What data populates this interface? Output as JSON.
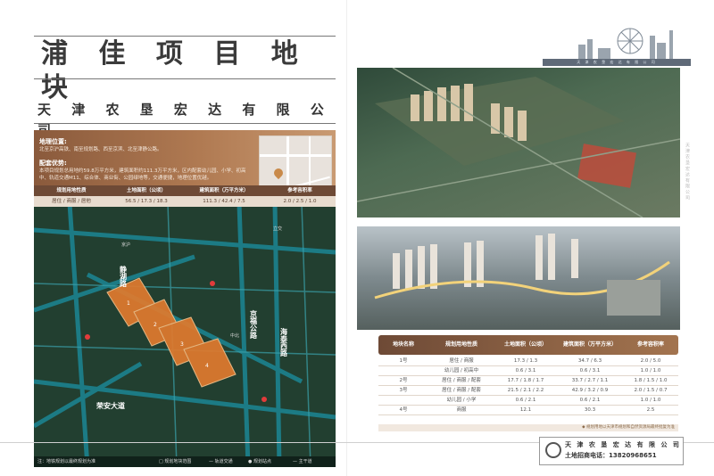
{
  "title": "浦 佳 项 目 地 块",
  "subtitle": "天 津 农 垦 宏 达 有 限 公 司",
  "info": {
    "location_title": "地理位置:",
    "location_text": "北至京沪高铁、南至规划路、西至京滨、北至津静公路。",
    "advantage_title": "配套优势:",
    "advantage_text": "本项目规划总用地约59.8万平方米，建筑面积约111.3万平方米，区内配套幼儿园、小学、初高中、轨道交通M11、综合体、商业街、公园绿地等，交通便捷，地理位置优越。"
  },
  "summary_table": {
    "headers": [
      "规划用地性质",
      "土地面积（公顷）",
      "建筑面积（万平方米）",
      "参考容积率"
    ],
    "row": [
      "居住 / 商服 / 居他",
      "56.5 / 17.3 / 18.3",
      "111.3 / 42.4 / 7.5",
      "2.0 / 2.5 / 1.0"
    ]
  },
  "map": {
    "parcels": [
      "1",
      "2",
      "3",
      "4"
    ],
    "roads": [
      "京福公路",
      "海泰西路",
      "静湖路",
      "荣安大道",
      "立交",
      "京沪",
      "中北"
    ],
    "legend": [
      "□ 规划地块范围",
      "— 轨道交通",
      "● 规划站点",
      "— 主干道"
    ],
    "legend_note": "注：地铁规划以最终规划为准"
  },
  "detail_table": {
    "headers": [
      "地块名称",
      "规划用地性质",
      "土地面积（公顷）",
      "建筑面积（万平方米）",
      "参考容积率"
    ],
    "rows": [
      [
        "1号",
        "居住 / 商服",
        "17.3 / 1.3",
        "34.7 / 6.3",
        "2.0 / 5.0"
      ],
      [
        "",
        "幼儿园 / 初高中",
        "0.6 / 3.1",
        "0.6 / 3.1",
        "1.0 / 1.0"
      ],
      [
        "2号",
        "居住 / 商服 / 配套",
        "17.7 / 1.8 / 1.7",
        "33.7 / 2.7 / 1.1",
        "1.8 / 1.5 / 1.0"
      ],
      [
        "3号",
        "居住 / 商服 / 配套",
        "21.5 / 2.1 / 2.2",
        "42.9 / 3.2 / 0.9",
        "2.0 / 1.5 / 0.7"
      ],
      [
        "",
        "幼儿园 / 小学",
        "0.6 / 2.1",
        "0.6 / 2.1",
        "1.0 / 1.0"
      ],
      [
        "4号",
        "商服",
        "12.1",
        "30.3",
        "2.5"
      ]
    ],
    "note": "◆ 规划用地以天津市规划和自然资源局最终批复为准"
  },
  "contact": {
    "company": "天 津 农 垦 宏 达 有 限 公 司",
    "phone": "土地招商电话：13820968651"
  },
  "logo_bar_text": "天 津 农 垦 宏 达 有 限 公 司",
  "colors": {
    "brown": "#8a5a3c",
    "map_green": "#1f3a2c",
    "parcel_orange": "#e07a2e"
  }
}
